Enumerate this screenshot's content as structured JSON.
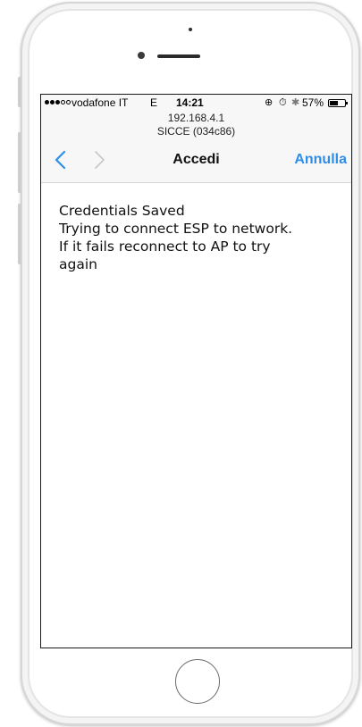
{
  "status_bar": {
    "carrier": "vodafone IT",
    "network": "E",
    "time": "14:21",
    "battery_percent": "57%",
    "battery_level": 0.57,
    "signal_bars_filled": 3,
    "signal_bars_total": 5,
    "icons": [
      "orientation-lock-icon",
      "alarm-icon",
      "bluetooth-icon"
    ]
  },
  "header": {
    "url": "192.168.4.1",
    "network_name": "SICCE (034c86)"
  },
  "nav": {
    "back_icon": "chevron-left-icon",
    "forward_icon": "chevron-right-icon",
    "title": "Accedi",
    "cancel_label": "Annulla",
    "accent_color": "#2e8ee8"
  },
  "content": {
    "lines": [
      "Credentials Saved",
      "Trying to connect ESP to network.",
      "If it fails reconnect to AP to try",
      "again"
    ]
  },
  "device": {
    "home_button_icon": "home-button"
  }
}
